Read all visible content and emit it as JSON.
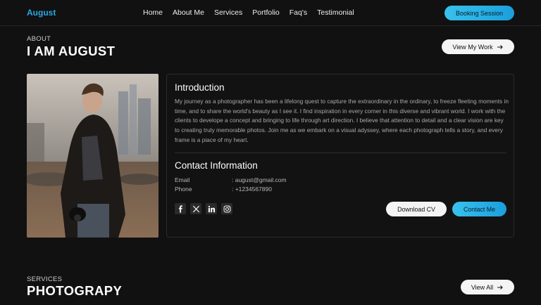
{
  "nav": {
    "brand": "August",
    "links": [
      "Home",
      "About Me",
      "Services",
      "Portfolio",
      "Faq's",
      "Testimonial"
    ],
    "cta": "Booking Session"
  },
  "about": {
    "kicker": "ABOUT",
    "title": "I AM AUGUST",
    "button": "View My Work",
    "intro_heading": "Introduction",
    "intro_text": "My journey as a photographer has been a lifelong quest to capture the extraordinary in the ordinary, to freeze fleeting moments in time, and to share the world's beauty as I see it. I find inspiration in every corner in this diverse and vibrant world. I work with the clients to develope a concept and bringing to life through art direction. I believe that attention to detail and a clear vision are key to creating truly memorable photos. Join me as we embark on a visual adyssey, where each photograph tells a story, and every frame is a piace of my heart.",
    "contact_heading": "Contact Information",
    "email_label": "Email",
    "email_value": ": august@gmail.com",
    "phone_label": "Phone",
    "phone_value": ": +1234567890",
    "socials": [
      "facebook-icon",
      "x-icon",
      "linkedin-icon",
      "instagram-icon"
    ],
    "download_button": "Download CV",
    "contact_button": "Contact Me"
  },
  "services": {
    "kicker": "SERVICES",
    "title": "PHOTOGRAPY",
    "button": "View All"
  },
  "colors": {
    "background": "#111111",
    "accent": "#29a7e2",
    "card_border": "#2b2b2b"
  }
}
